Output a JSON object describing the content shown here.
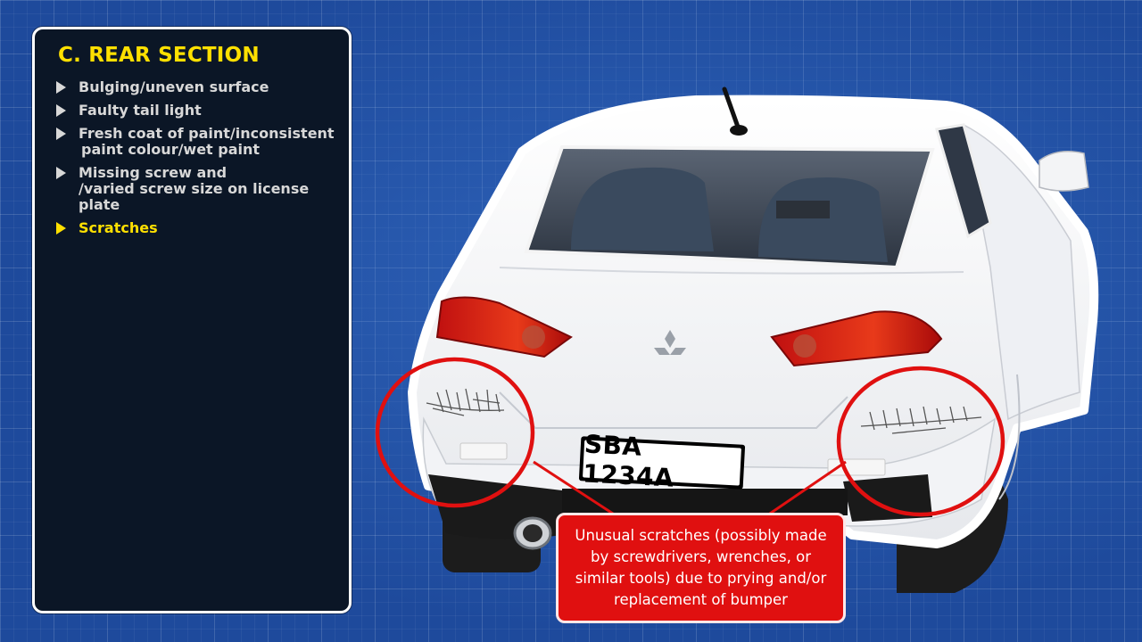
{
  "panel": {
    "title": "C. REAR SECTION",
    "items": [
      {
        "lines": [
          "Bulging/uneven surface"
        ],
        "active": false
      },
      {
        "lines": [
          "Faulty tail light"
        ],
        "active": false
      },
      {
        "lines": [
          "Fresh coat of paint/inconsistent",
          "paint colour/wet paint"
        ],
        "active": false
      },
      {
        "lines": [
          "Missing screw and",
          "/varied screw size on license plate"
        ],
        "active": false
      },
      {
        "lines": [
          "Scratches"
        ],
        "active": true
      }
    ]
  },
  "license_plate": "SBA 1234A",
  "callout": "Unusual scratches (possibly made by screwdrivers, wrenches, or similar tools) due to prying and/or replacement of bumper",
  "colors": {
    "background": "#1e4a9c",
    "panel": "#0b1626",
    "highlight": "#ffe000",
    "item_text": "#d8d8d8",
    "callout": "#e01010",
    "circle": "#e01010"
  },
  "icons": [
    "bullet-triangle-icon",
    "mitsubishi-logo-icon"
  ]
}
